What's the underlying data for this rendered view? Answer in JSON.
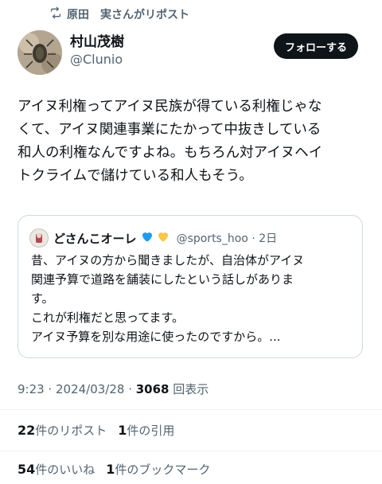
{
  "repost_banner": {
    "text": "原田　実さんがリポスト",
    "icon": "repost-icon"
  },
  "author": {
    "display_name": "村山茂樹",
    "handle": "@Clunio"
  },
  "follow_button": {
    "label": "フォローする"
  },
  "tweet": {
    "lines": [
      "アイヌ利権ってアイヌ民族が得ている利権じゃな",
      "くて、アイヌ関連事業にたかって中抜きしている",
      "和人の利権なんですよね。もちろん対アイヌヘイ",
      "トクライムで儲けている和人もそう。"
    ]
  },
  "quote": {
    "display_name": "どさんこオーレ",
    "emoji": [
      "blue-heart",
      "yellow-heart"
    ],
    "handle_time": "@sports_hoo · 2日",
    "lines": [
      "昔、アイヌの方から聞きましたが、自治体がアイヌ",
      "関連予算で道路を舗装にしたという話しがありま",
      "す。",
      "これが利権だと思ってます。",
      "アイヌ予算を別な用途に使ったのですから。..."
    ]
  },
  "meta": {
    "timestamp": "9:23 · 2024/03/28 · ",
    "views_count": "3068",
    "views_label": " 回表示"
  },
  "stats": {
    "reposts_count": "22",
    "reposts_label": "件のリポスト",
    "quotes_count": "1",
    "quotes_label": "件の引用",
    "likes_count": "54",
    "likes_label": "件のいいね",
    "bookmarks_count": "1",
    "bookmarks_label": "件のブックマーク"
  },
  "colors": {
    "text": "#0f1419",
    "secondary": "#536471",
    "border": "#cfd9de",
    "divider": "#eff3f4",
    "blue_heart": "#1d9bf0",
    "yellow_heart": "#f7c948"
  }
}
